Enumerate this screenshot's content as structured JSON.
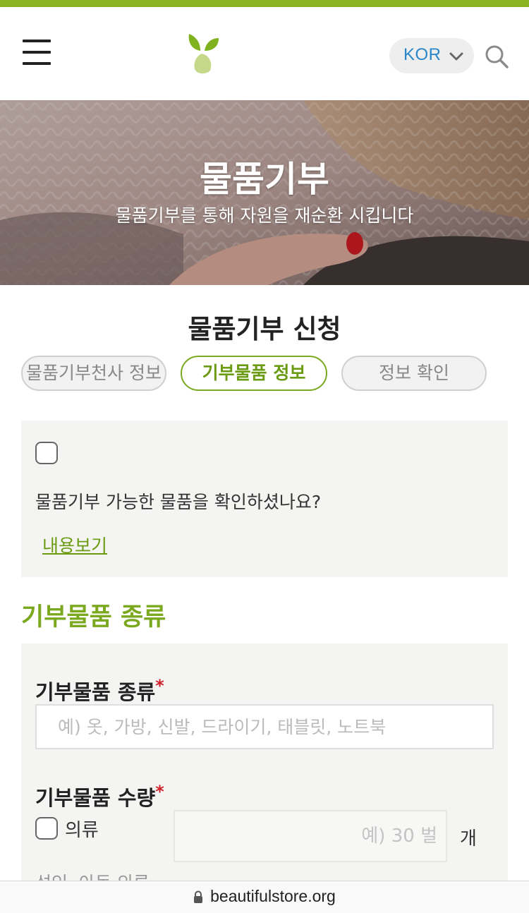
{
  "header": {
    "language": "KOR"
  },
  "hero": {
    "title": "물품기부",
    "subtitle": "물품기부를 통해 자원을 재순환 시킵니다"
  },
  "page_title": "물품기부 신청",
  "steps": [
    {
      "label": "물품기부천사 정보",
      "state": "inactive"
    },
    {
      "label": "기부물품 정보",
      "state": "active"
    },
    {
      "label": "정보 확인",
      "state": "inactive"
    }
  ],
  "confirm": {
    "question": "물품기부 가능한 물품을 확인하셨나요?",
    "link_label": "내용보기"
  },
  "section": {
    "title": "기부물품 종류"
  },
  "form": {
    "kind_label": "기부물품 종류",
    "required_mark": "*",
    "kind_placeholder": "예) 옷, 가방, 신발, 드라이기, 태블릿, 노트북",
    "qty_label": "기부물품 수량",
    "clothing_label": "의류",
    "clothing_qty_placeholder": "예) 30 벌",
    "unit_label": "개",
    "cutoff_text": "성인, 아동 의류"
  },
  "browser": {
    "url": "beautifulstore.org"
  },
  "colors": {
    "brand_green": "#8bb31d",
    "link_green": "#6b9b12",
    "lang_blue": "#2a86c8",
    "required_red": "#d0202a"
  },
  "icons": [
    "hamburger-menu-icon",
    "leaf-logo-icon",
    "chevron-down-icon",
    "search-icon",
    "lock-icon"
  ]
}
